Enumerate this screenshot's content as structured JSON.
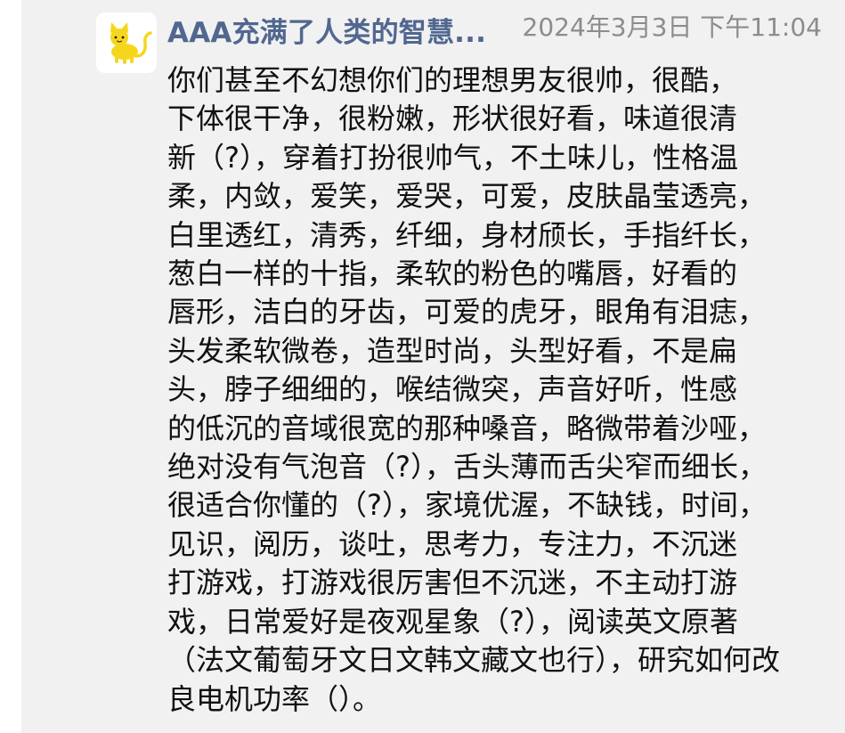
{
  "conversation": {
    "sender_name": "AAA充满了人类的智慧...",
    "timestamp": "2024年3月3日 下午11:04",
    "avatar_icon": "yellow-cat-icon",
    "message_lines": [
      "你们甚至不幻想你们的理想男友很帅，很酷，",
      "下体很干净，很粉嫩，形状很好看，味道很清",
      "新（?），穿着打扮很帅气，不土味儿，性格温",
      "柔，内敛，爱笑，爱哭，可爱，皮肤晶莹透亮，",
      "白里透红，清秀，纤细，身材颀长，手指纤长，",
      "葱白一样的十指，柔软的粉色的嘴唇，好看的",
      "唇形，洁白的牙齿，可爱的虎牙，眼角有泪痣，",
      "头发柔软微卷，造型时尚，头型好看，不是扁",
      "头，脖子细细的，喉结微突，声音好听，性感",
      "的低沉的音域很宽的那种嗓音，略微带着沙哑，",
      "绝对没有气泡音（?），舌头薄而舌尖窄而细长，",
      "很适合你懂的（?），家境优渥，不缺钱，时间，",
      "见识，阅历，谈吐，思考力，专注力，不沉迷",
      "打游戏，打游戏很厉害但不沉迷，不主动打游",
      "戏，日常爱好是夜观星象（?），阅读英文原著",
      "（法文葡萄牙文日文韩文藏文也行），研究如何改",
      "良电机功率（）。"
    ]
  },
  "colors": {
    "panel_background": "#f1f1f1",
    "sender_name": "#51678f",
    "timestamp": "#8c8c8c",
    "message_text": "#111111",
    "avatar_cat": "#f5d61c"
  }
}
